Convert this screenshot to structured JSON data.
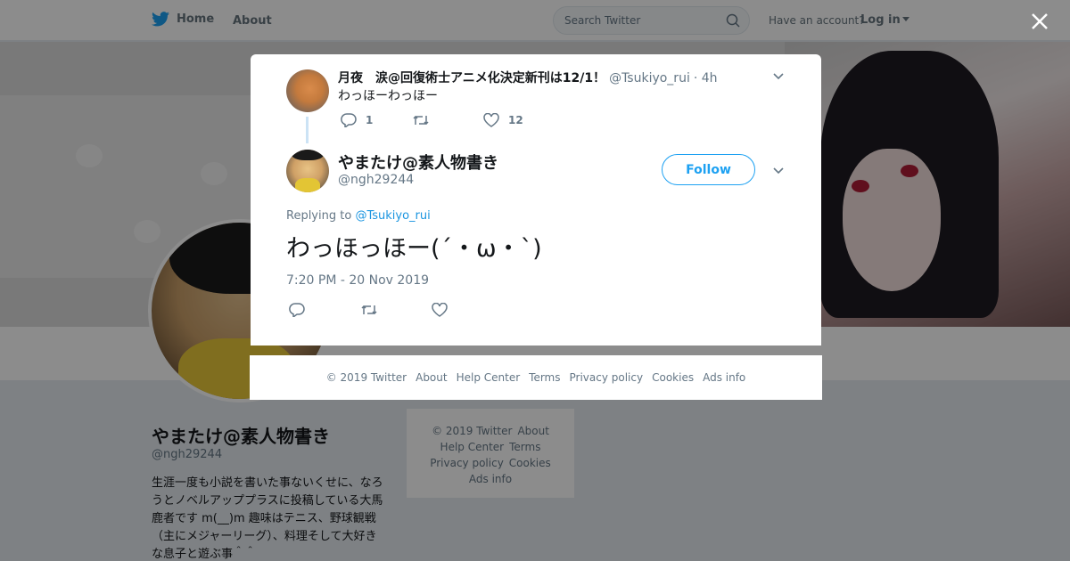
{
  "topnav": {
    "home_label": "Home",
    "about_label": "About",
    "search_placeholder": "Search Twitter",
    "have_account": "Have an account?",
    "login_label": "Log in"
  },
  "profile": {
    "name": "やまたけ@素人物書き",
    "handle": "@ngh29244",
    "bio": "生涯一度も小説を書いた事ないくせに、なろうとノベルアッププラスに投稿している大馬鹿者です m(__)m 趣味はテニス、野球観戦（主にメジャーリーグ）、料理そして大好きな息子と遊ぶ事＾＾"
  },
  "sidebar_footer": {
    "copyright": "© 2019 Twitter",
    "about": "About",
    "help": "Help Center",
    "terms": "Terms",
    "privacy": "Privacy policy",
    "cookies": "Cookies",
    "ads": "Ads info"
  },
  "parent_tweet": {
    "author_name": "月夜　涙@回復術士アニメ化決定新刊は12/1！",
    "author_handle": "@Tsukiyo_rui",
    "time": "· 4h",
    "text": "わっほーわっほー",
    "reply_count": "1",
    "retweet_count": "",
    "like_count": "12"
  },
  "main_tweet": {
    "author_name": "やまたけ@素人物書き",
    "author_handle": "@ngh29244",
    "follow_label": "Follow",
    "replying_prefix": "Replying to",
    "replying_to": "@Tsukiyo_rui",
    "text": "わっほっほー(´・ω・`)",
    "timestamp": "7:20 PM - 20 Nov 2019"
  },
  "modal_footer": {
    "copyright": "© 2019 Twitter",
    "about": "About",
    "help": "Help Center",
    "terms": "Terms",
    "privacy": "Privacy policy",
    "cookies": "Cookies",
    "ads": "Ads info"
  },
  "colors": {
    "accent": "#1da1f2",
    "secondary_text": "#657786"
  }
}
